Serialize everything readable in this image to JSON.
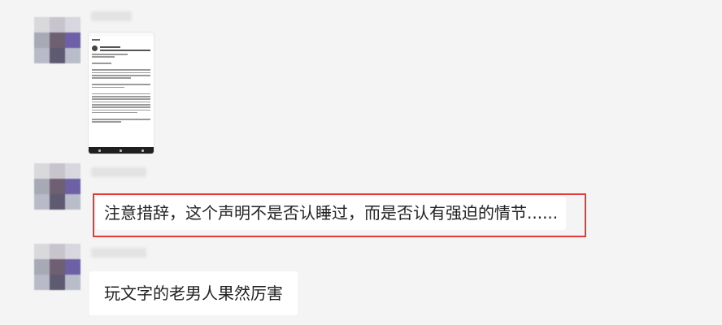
{
  "colors": {
    "background": "#f4f4f4",
    "bubble": "#ffffff",
    "highlight_border": "#e03c3c",
    "text": "#222222"
  },
  "messages": [
    {
      "type": "image",
      "content": "phone-screenshot-thumbnail"
    },
    {
      "type": "text",
      "text": "注意措辞，这个声明不是否认睡过，而是否认有强迫的情节......",
      "highlighted": true
    },
    {
      "type": "text",
      "text": "玩文字的老男人果然厉害",
      "highlighted": false
    }
  ]
}
